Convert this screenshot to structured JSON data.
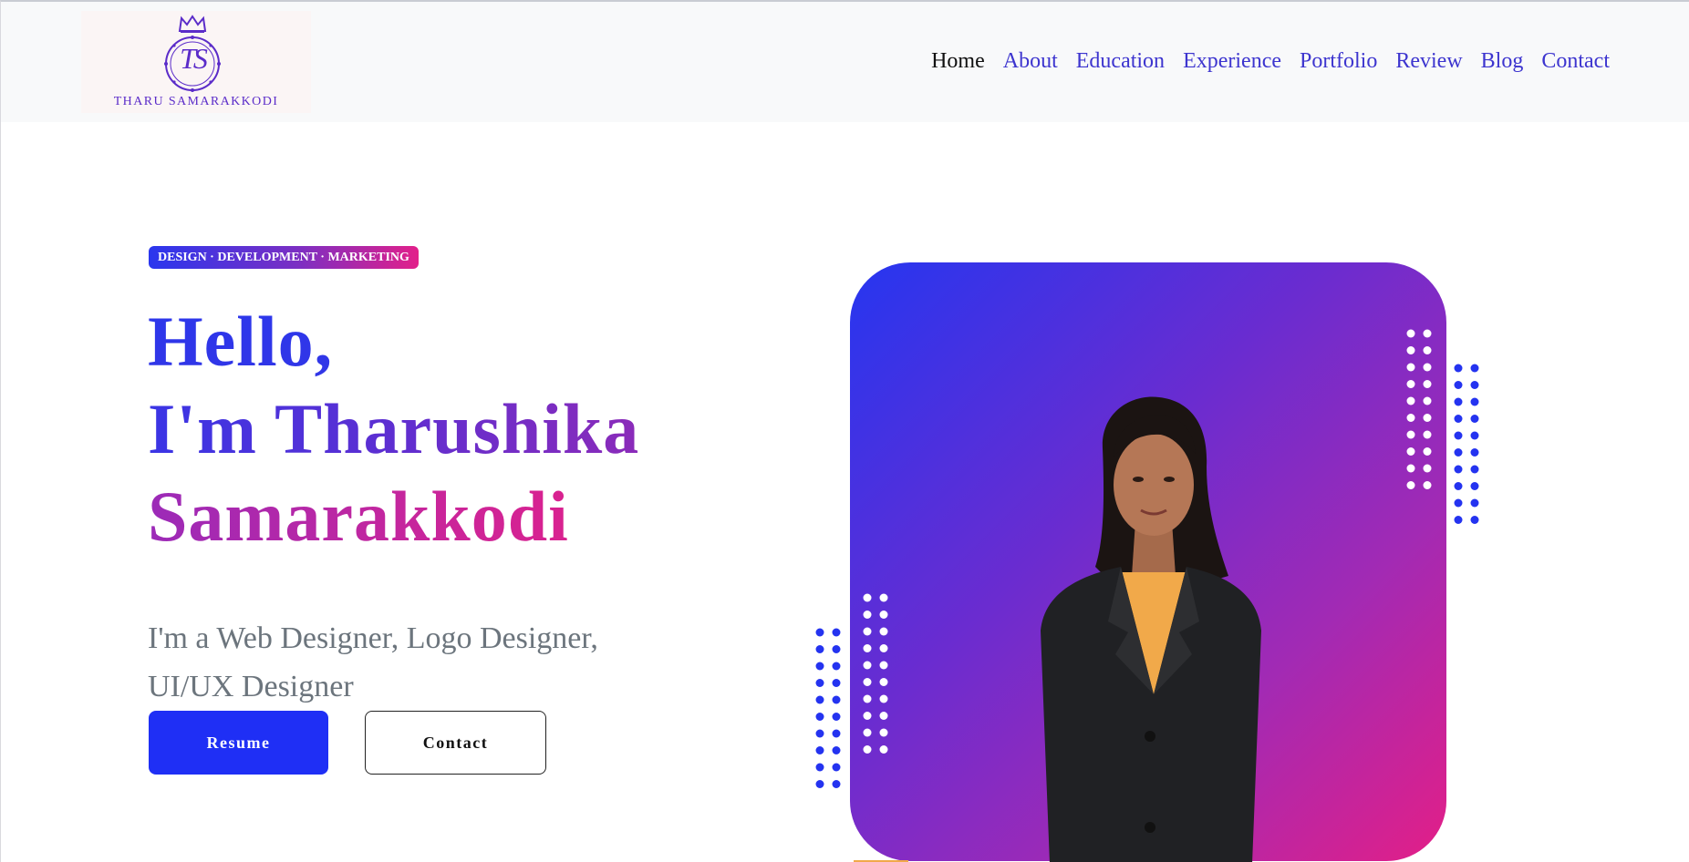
{
  "brand": {
    "initials": "TS",
    "name": "THARU SAMARAKKODI"
  },
  "nav": {
    "items": [
      {
        "label": "Home",
        "active": true
      },
      {
        "label": "About",
        "active": false
      },
      {
        "label": "Education",
        "active": false
      },
      {
        "label": "Experience",
        "active": false
      },
      {
        "label": "Portfolio",
        "active": false
      },
      {
        "label": "Review",
        "active": false
      },
      {
        "label": "Blog",
        "active": false
      },
      {
        "label": "Contact",
        "active": false
      }
    ]
  },
  "hero": {
    "tagline": "DESIGN · DEVELOPMENT · MARKETING",
    "title_line1": "Hello,",
    "title_line2": "I'm Tharushika",
    "title_line3": "Samarakkodi",
    "subtitle": "I'm a Web Designer, Logo Designer, UI/UX Designer",
    "resume_label": "Resume",
    "contact_label": "Contact"
  },
  "colors": {
    "primary": "#1f2ff5",
    "gradient_start": "#2636f0",
    "gradient_mid": "#6a2cd0",
    "gradient_end": "#e31f87",
    "nav_link": "#3d35cf",
    "nav_active": "#111111",
    "subtitle": "#6c757d"
  }
}
